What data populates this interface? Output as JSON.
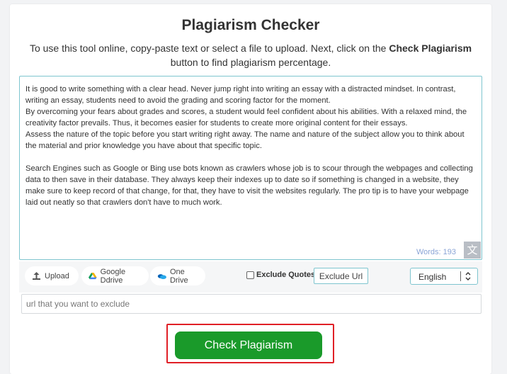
{
  "header": {
    "title": "Plagiarism Checker",
    "subtitle_before": "To use this tool online, copy-paste text or select a file to upload. Next, click on the ",
    "subtitle_bold": "Check Plagiarism",
    "subtitle_after": " button to find plagiarism percentage."
  },
  "editor": {
    "text": "It is good to write something with a clear head. Never jump right into writing an essay with a distracted mindset. In contrast,\nwriting an essay, students need to avoid the grading and scoring factor for the moment.\nBy overcoming your fears about grades and scores, a student would feel confident about his abilities. With a relaxed mind, the\ncreativity factor prevails. Thus, it becomes easier for students to create more original content for their essays.\nAssess the nature of the topic before you start writing right away. The name and nature of the subject allow you to think about\nthe material and prior knowledge you have about that specific topic.\n\nSearch Engines such as Google or Bing use bots known as crawlers whose job is to scour through the webpages and collecting\ndata to then save in their database. They always keep their indexes up to date so if something is changed in a website, they\nmake sure to keep record of that change, for that, they have to visit the websites regularly. The pro tip is to have your webpage\nlaid out neatly so that crawlers don't have to much work.",
    "word_count": "Words: 193"
  },
  "toolbar": {
    "upload_label": "Upload",
    "gdrive_label": "Google Ddrive",
    "onedrive_label": "One Drive",
    "exclude_quotes_label": "Exclude Quotes",
    "exclude_url_label": "Exclude Url",
    "language_value": "English"
  },
  "url_input": {
    "placeholder": "url that you want to exclude"
  },
  "actions": {
    "check_label": "Check Plagiarism"
  },
  "colors": {
    "accent_border": "#7ec5cf",
    "primary_button": "#1a9a2a",
    "highlight": "#e01f26"
  },
  "icons": [
    "upload-icon",
    "google-drive-icon",
    "onedrive-icon",
    "translate-icon",
    "chevron-updown-icon"
  ]
}
